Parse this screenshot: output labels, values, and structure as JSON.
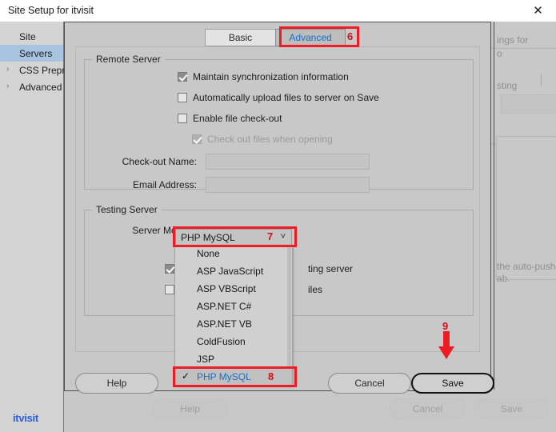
{
  "window": {
    "title": "Site Setup for itvisit",
    "close_icon": "close-icon"
  },
  "sidebar": {
    "items": [
      {
        "label": "Site",
        "selected": false,
        "chevron": ""
      },
      {
        "label": "Servers",
        "selected": true,
        "chevron": ""
      },
      {
        "label": "CSS Prepro",
        "selected": false,
        "chevron": "›"
      },
      {
        "label": "Advanced",
        "selected": false,
        "chevron": "›"
      }
    ]
  },
  "tabs": {
    "basic": "Basic",
    "advanced": "Advanced",
    "active": "Advanced"
  },
  "remote_server": {
    "legend": "Remote Server",
    "checkboxes": [
      {
        "label": "Maintain synchronization information",
        "checked": true,
        "disabled": false
      },
      {
        "label": "Automatically upload files to server on Save",
        "checked": false,
        "disabled": false
      },
      {
        "label": "Enable file check-out",
        "checked": false,
        "disabled": false
      },
      {
        "label": "Check out files when opening",
        "checked": true,
        "disabled": true
      }
    ],
    "fields": [
      {
        "label": "Check-out Name:",
        "value": "",
        "placeholder": ""
      },
      {
        "label": "Email Address:",
        "value": "",
        "placeholder": ""
      }
    ]
  },
  "testing_server": {
    "legend": "Testing Server",
    "server_model_label": "Server Model:",
    "server_model_value": "PHP MySQL",
    "caret_icon": "chevron-down-icon",
    "options": [
      {
        "label": "None",
        "selected": false
      },
      {
        "label": "ASP JavaScript",
        "selected": false
      },
      {
        "label": "ASP VBScript",
        "selected": false
      },
      {
        "label": "ASP.NET C#",
        "selected": false
      },
      {
        "label": "ASP.NET VB",
        "selected": false
      },
      {
        "label": "ColdFusion",
        "selected": false
      },
      {
        "label": "JSP",
        "selected": false
      },
      {
        "label": "PHP MySQL",
        "selected": true
      }
    ],
    "obscured_checkbox_rows": [
      {
        "checked": true,
        "label_fragment": "ting server"
      },
      {
        "checked": false,
        "label_fragment": "iles"
      }
    ]
  },
  "dialog_buttons": {
    "help": "Help",
    "cancel": "Cancel",
    "save": "Save"
  },
  "outer_footer": {
    "help": "Help",
    "cancel": "Cancel",
    "save": "Save"
  },
  "background": {
    "fragments": [
      {
        "text": "ings for"
      },
      {
        "text": "o"
      },
      {
        "text": "sting"
      },
      {
        "text": "the auto-push"
      },
      {
        "text": "ab."
      }
    ]
  },
  "annotations": [
    {
      "id": "6",
      "target": "advanced-tab"
    },
    {
      "id": "7",
      "target": "server-model-combobox"
    },
    {
      "id": "8",
      "target": "dropdown-option-php-mysql"
    },
    {
      "id": "9",
      "target": "save-button"
    }
  ],
  "watermark": "itvisit",
  "colors": {
    "annotation_red": "#ee1c25",
    "selection_blue": "#a8c4e0",
    "link_blue": "#1a6ec0",
    "watermark_blue": "#2b5fd9"
  }
}
